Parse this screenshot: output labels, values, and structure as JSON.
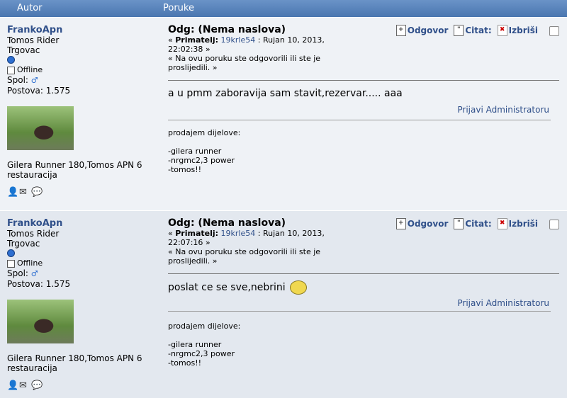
{
  "header": {
    "author_col": "Autor",
    "messages_col": "Poruke"
  },
  "posts": [
    {
      "author": {
        "name": "FrankoApn",
        "rank": "Tomos Rider",
        "location": "Trgovac",
        "status": "Offline",
        "gender_label": "Spol:",
        "posts_label": "Postova: 1.575",
        "bike": "Gilera Runner 180,Tomos APN 6 restauracija"
      },
      "subject": "Odg: (Nema naslova)",
      "meta_prefix": "«",
      "recipient_label": "Primatelj:",
      "recipient": "19krle54",
      "date": ": Rujan 10, 2013, 22:02:38 »",
      "quote_note": "« Na ovu poruku ste odgovorili ili ste je proslijedili. »",
      "actions": {
        "reply": "Odgovor",
        "quote": "Citat:",
        "delete": "Izbriši"
      },
      "body": "a u pmm zaboravija sam stavit,rezervar..... aaa",
      "report": "Prijavi Administratoru",
      "signature": [
        "prodajem dijelove:",
        "",
        "-gilera runner",
        "-nrgmc2,3 power",
        "-tomos!!"
      ]
    },
    {
      "author": {
        "name": "FrankoApn",
        "rank": "Tomos Rider",
        "location": "Trgovac",
        "status": "Offline",
        "gender_label": "Spol:",
        "posts_label": "Postova: 1.575",
        "bike": "Gilera Runner 180,Tomos APN 6 restauracija"
      },
      "subject": "Odg: (Nema naslova)",
      "meta_prefix": "«",
      "recipient_label": "Primatelj:",
      "recipient": "19krle54",
      "date": ": Rujan 10, 2013, 22:07:16 »",
      "quote_note": "« Na ovu poruku ste odgovorili ili ste je proslijedili. »",
      "actions": {
        "reply": "Odgovor",
        "quote": "Citat:",
        "delete": "Izbriši"
      },
      "body": "poslat ce se sve,nebrini",
      "report": "Prijavi Administratoru",
      "signature": [
        "prodajem dijelove:",
        "",
        "-gilera runner",
        "-nrgmc2,3 power",
        "-tomos!!"
      ]
    }
  ],
  "colors": {
    "header": "#4f7ab4",
    "link": "#30508a",
    "row_a": "#eff2f6",
    "row_b": "#e3e8ef"
  }
}
